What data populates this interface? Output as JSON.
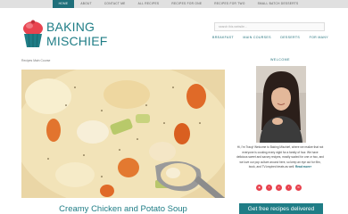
{
  "topnav": {
    "items": [
      {
        "label": "Home"
      },
      {
        "label": "About"
      },
      {
        "label": "Contact Me"
      },
      {
        "label": "All Recipes"
      },
      {
        "label": "Recipes for One"
      },
      {
        "label": "Recipes for Two"
      },
      {
        "label": "Small Batch Desserts"
      }
    ]
  },
  "logo": {
    "line1": "BAKING",
    "line2": "MISCHIEF",
    "brand_color": "#1f7d86",
    "accent": "#e8434f"
  },
  "search": {
    "placeholder": "search this website..."
  },
  "subnav": {
    "items": [
      {
        "label": "Breakfast"
      },
      {
        "label": "Main Courses"
      },
      {
        "label": "Desserts"
      },
      {
        "label": "For Many"
      }
    ]
  },
  "breadcrumb": {
    "text": "Recipes Main Course"
  },
  "post": {
    "title": "Creamy Chicken and Potato Soup"
  },
  "sidebar": {
    "welcome": "Welcome",
    "bio": "Hi, I'm Tracy! Welcome to Baking Mischief, where we realize that not everyone is cooking every night for a family of four. We have delicious sweet and savory recipes, mostly scaled for one or two, and we love our pop culture around here, so keep an eye out for film, book, and TV-inspired treats as well.",
    "read_more": "Read more»",
    "social_icons": [
      "instagram-icon",
      "facebook-icon",
      "pinterest-icon",
      "twitter-icon",
      "email-icon"
    ],
    "cta": "Get free recipes delivered"
  }
}
